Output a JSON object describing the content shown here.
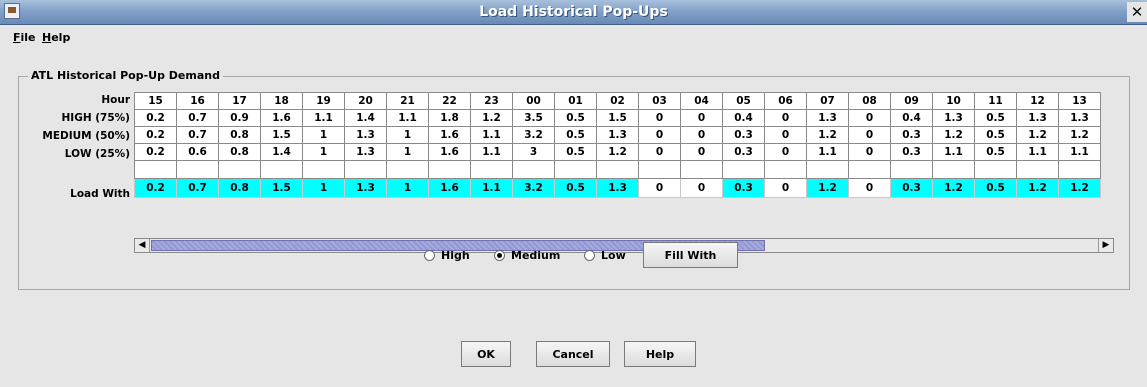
{
  "window": {
    "title": "Load Historical Pop-Ups",
    "close_glyph": "✕"
  },
  "menu": [
    {
      "label": "File",
      "mnemonic": "F",
      "rest": "ile"
    },
    {
      "label": "Help",
      "mnemonic": "H",
      "rest": "elp"
    }
  ],
  "panel": {
    "title": "ATL Historical Pop-Up Demand"
  },
  "row_labels": {
    "hour": "Hour",
    "high": "HIGH (75%)",
    "medium": "MEDIUM (50%)",
    "low": "LOW (25%)",
    "load_with": "Load With"
  },
  "table": {
    "hours": [
      "15",
      "16",
      "17",
      "18",
      "19",
      "20",
      "21",
      "22",
      "23",
      "00",
      "01",
      "02",
      "03",
      "04",
      "05",
      "06",
      "07",
      "08",
      "09",
      "10",
      "11",
      "12",
      "13"
    ],
    "high": [
      "0.2",
      "0.7",
      "0.9",
      "1.6",
      "1.1",
      "1.4",
      "1.1",
      "1.8",
      "1.2",
      "3.5",
      "0.5",
      "1.5",
      "0",
      "0",
      "0.4",
      "0",
      "1.3",
      "0",
      "0.4",
      "1.3",
      "0.5",
      "1.3",
      "1.3"
    ],
    "medium": [
      "0.2",
      "0.7",
      "0.8",
      "1.5",
      "1",
      "1.3",
      "1",
      "1.6",
      "1.1",
      "3.2",
      "0.5",
      "1.3",
      "0",
      "0",
      "0.3",
      "0",
      "1.2",
      "0",
      "0.3",
      "1.2",
      "0.5",
      "1.2",
      "1.2"
    ],
    "low": [
      "0.2",
      "0.6",
      "0.8",
      "1.4",
      "1",
      "1.3",
      "1",
      "1.6",
      "1.1",
      "3",
      "0.5",
      "1.2",
      "0",
      "0",
      "0.3",
      "0",
      "1.1",
      "0",
      "0.3",
      "1.1",
      "0.5",
      "1.1",
      "1.1"
    ],
    "load_with": [
      "0.2",
      "0.7",
      "0.8",
      "1.5",
      "1",
      "1.3",
      "1",
      "1.6",
      "1.1",
      "3.2",
      "0.5",
      "1.3",
      "0",
      "0",
      "0.3",
      "0",
      "1.2",
      "0",
      "0.3",
      "1.2",
      "0.5",
      "1.2",
      "1.2"
    ],
    "load_highlight_color": "#00ffff"
  },
  "scrollbar": {
    "left_arrow": "◀",
    "right_arrow": "▶"
  },
  "options": {
    "radios": [
      {
        "label": "High",
        "selected": false
      },
      {
        "label": "Medium",
        "selected": true
      },
      {
        "label": "Low",
        "selected": false
      }
    ],
    "fill_button": "Fill With"
  },
  "buttons": {
    "ok": "OK",
    "cancel": "Cancel",
    "help": "Help"
  }
}
